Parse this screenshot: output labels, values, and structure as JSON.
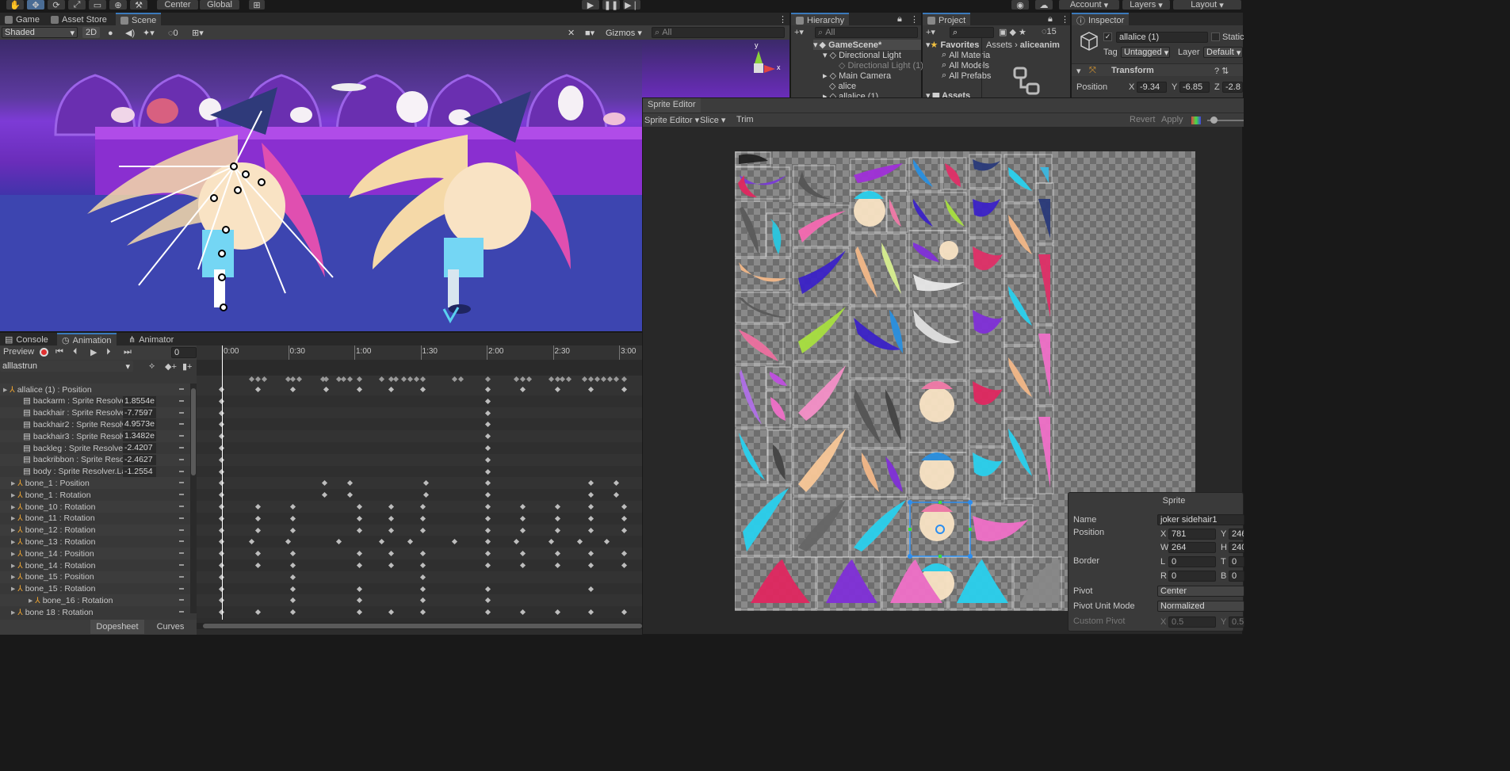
{
  "toolbar": {
    "center_label": "Center",
    "global_label": "Global",
    "account_label": "Account",
    "layers_label": "Layers",
    "layout_label": "Layout"
  },
  "scene_panel": {
    "tabs": [
      {
        "label": "Game"
      },
      {
        "label": "Asset Store"
      },
      {
        "label": "Scene"
      }
    ],
    "shading_mode": "Shaded",
    "mode_2d": "2D",
    "hidden_count": "0",
    "gizmos_label": "Gizmos",
    "search_placeholder": "All",
    "axis_y": "y",
    "axis_x": "x"
  },
  "hierarchy": {
    "tab_label": "Hierarchy",
    "search_placeholder": "All",
    "items": [
      {
        "label": "GameScene*"
      },
      {
        "label": "Directional Light"
      },
      {
        "label": "Directional Light (1)"
      },
      {
        "label": "Main Camera"
      },
      {
        "label": "alice"
      },
      {
        "label": "allalice (1)"
      }
    ]
  },
  "project": {
    "tab_label": "Project",
    "favorites_label": "Favorites",
    "favorites": [
      {
        "label": "All Materia"
      },
      {
        "label": "All Models"
      },
      {
        "label": "All Prefabs"
      }
    ],
    "assets_label": "Assets",
    "breadcrumb_root": "Assets",
    "breadcrumb_child": "aliceanim",
    "hidden_count": "15"
  },
  "inspector": {
    "tab_label": "Inspector",
    "object_name": "allalice (1)",
    "static_label": "Static",
    "tag_label": "Tag",
    "tag_value": "Untagged",
    "layer_label": "Layer",
    "layer_value": "Default",
    "transform_label": "Transform",
    "position_label": "Position",
    "pos_x_label": "X",
    "pos_x": "-9.34",
    "pos_y_label": "Y",
    "pos_y": "-6.85",
    "pos_z_label": "Z",
    "pos_z": "-2.8"
  },
  "sprite_editor": {
    "title": "Sprite Editor",
    "menu_label": "Sprite Editor",
    "slice_label": "Slice",
    "trim_label": "Trim",
    "revert_label": "Revert",
    "apply_label": "Apply"
  },
  "sprite_panel": {
    "title": "Sprite",
    "name_label": "Name",
    "name_value": "joker sidehair1",
    "position_label": "Position",
    "x_label": "X",
    "x_value": "781",
    "y_label": "Y",
    "y_value": "246",
    "w_label": "W",
    "w_value": "264",
    "h_label": "H",
    "h_value": "240",
    "border_label": "Border",
    "l_label": "L",
    "l_value": "0",
    "t_label": "T",
    "t_value": "0",
    "r_label": "R",
    "r_value": "0",
    "b_label": "B",
    "b_value": "0",
    "pivot_label": "Pivot",
    "pivot_value": "Center",
    "pivot_unit_label": "Pivot Unit Mode",
    "pivot_unit_value": "Normalized",
    "custom_pivot_label": "Custom Pivot",
    "cp_x_label": "X",
    "cp_x_value": "0.5",
    "cp_y_label": "Y",
    "cp_y_value": "0.5"
  },
  "animation": {
    "tabs": [
      {
        "label": "Console"
      },
      {
        "label": "Animation"
      },
      {
        "label": "Animator"
      }
    ],
    "preview_label": "Preview",
    "frame_value": "0",
    "clip_name": "alllastrun",
    "time_labels": [
      "0:00",
      "0:30",
      "1:00",
      "1:30",
      "2:00",
      "2:30",
      "3:00"
    ],
    "properties": [
      {
        "label": "allalice (1) : Position",
        "value": ""
      },
      {
        "label": "backarm : Sprite Resolver",
        "value": "1.8554e"
      },
      {
        "label": "backhair : Sprite Resolver",
        "value": "-7.7597"
      },
      {
        "label": "backhair2 : Sprite Resolve",
        "value": "4.9573e"
      },
      {
        "label": "backhair3 : Sprite Resolve",
        "value": "1.3482e"
      },
      {
        "label": "backleg : Sprite Resolver.",
        "value": "-2.4207"
      },
      {
        "label": "backribbon : Sprite Resolv",
        "value": "-2.4627"
      },
      {
        "label": "body : Sprite Resolver.Lal",
        "value": "-1.2554"
      },
      {
        "label": "bone_1 : Position",
        "value": ""
      },
      {
        "label": "bone_1 : Rotation",
        "value": ""
      },
      {
        "label": "bone_10 : Rotation",
        "value": ""
      },
      {
        "label": "bone_11 : Rotation",
        "value": ""
      },
      {
        "label": "bone_12 : Rotation",
        "value": ""
      },
      {
        "label": "bone_13 : Rotation",
        "value": ""
      },
      {
        "label": "bone_14 : Position",
        "value": ""
      },
      {
        "label": "bone_14 : Rotation",
        "value": ""
      },
      {
        "label": "bone_15 : Position",
        "value": ""
      },
      {
        "label": "bone_15 : Rotation",
        "value": ""
      },
      {
        "label": "bone_16 : Rotation",
        "value": ""
      },
      {
        "label": "bone 18 : Rotation",
        "value": ""
      }
    ],
    "dopesheet_label": "Dopesheet",
    "curves_label": "Curves"
  },
  "colors": {
    "accent": "#3a79bb",
    "panel": "#383838",
    "dark": "#282828",
    "keyframe": "#bdbdbd",
    "selection": "#2b8ef0"
  }
}
